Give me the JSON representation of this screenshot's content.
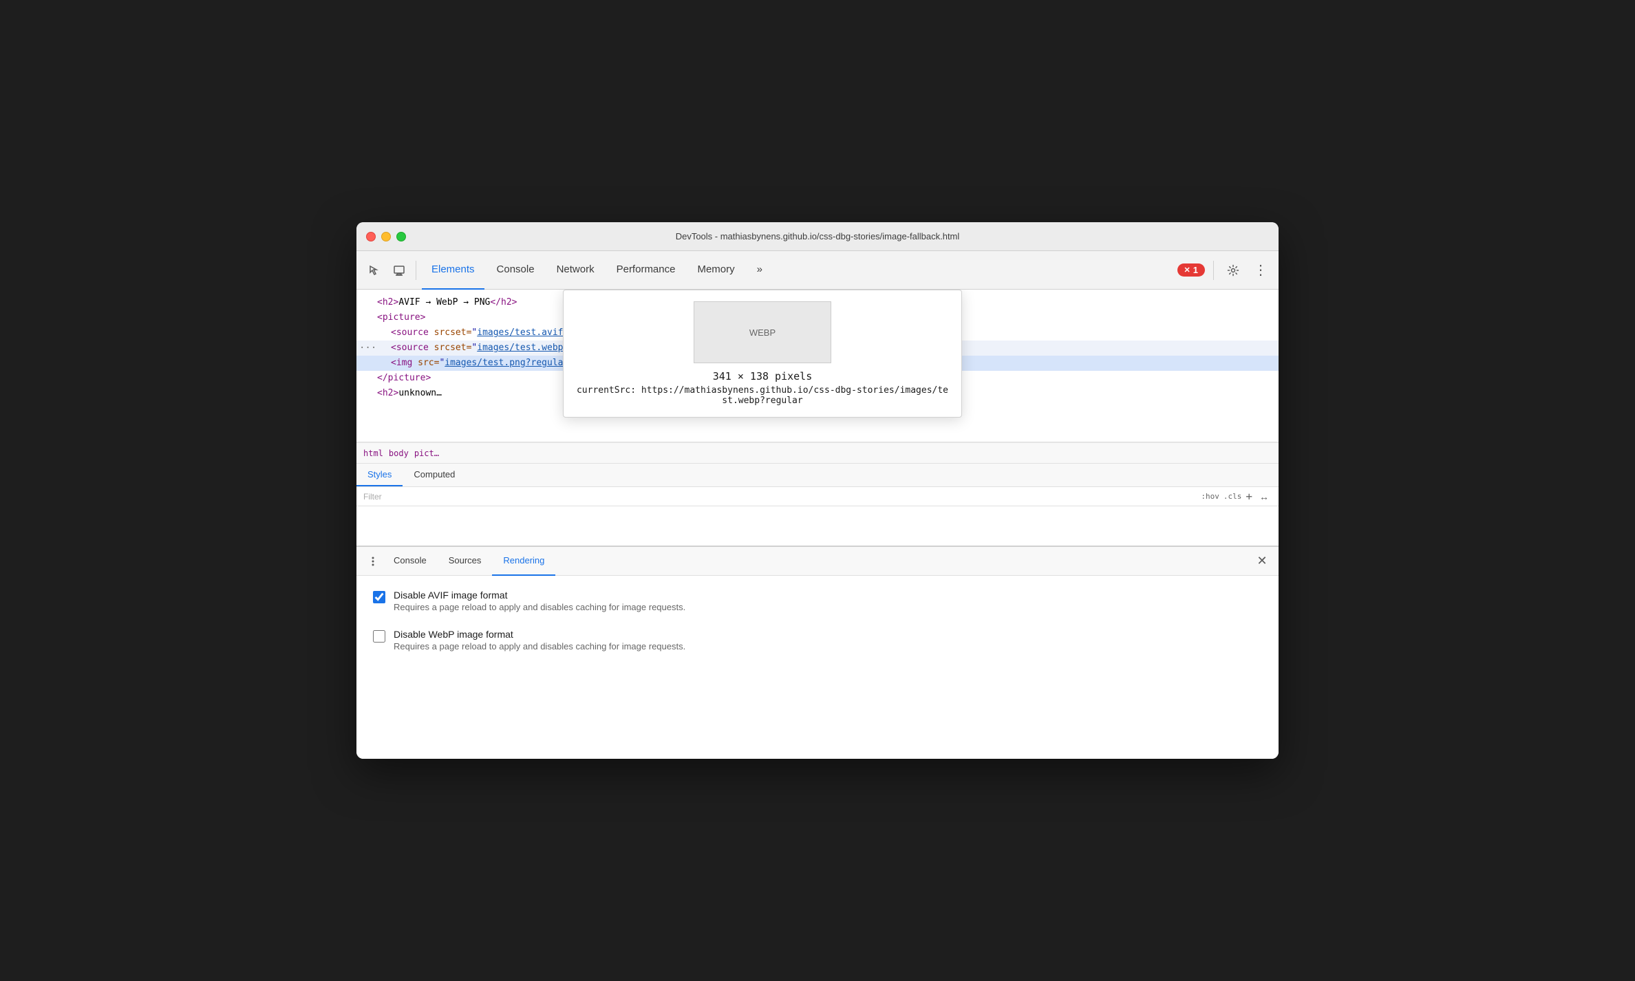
{
  "window": {
    "title": "DevTools - mathiasbynens.github.io/css-dbg-stories/image-fallback.html"
  },
  "toolbar": {
    "tabs": [
      {
        "id": "elements",
        "label": "Elements",
        "active": true
      },
      {
        "id": "console",
        "label": "Console",
        "active": false
      },
      {
        "id": "network",
        "label": "Network",
        "active": false
      },
      {
        "id": "performance",
        "label": "Performance",
        "active": false
      },
      {
        "id": "memory",
        "label": "Memory",
        "active": false
      },
      {
        "id": "more",
        "label": "»",
        "active": false
      }
    ],
    "error_count": "1",
    "settings_label": "⚙",
    "more_label": "⋮"
  },
  "elements": {
    "lines": [
      {
        "text": "<h2>AVIF → WebP → PNG</h2>",
        "indent": 0,
        "type": "tag"
      },
      {
        "text": "<picture>",
        "indent": 1,
        "type": "tag"
      },
      {
        "text": "<source srcset=\"images/test.avif?regular\"  type=\"image/avif\">",
        "indent": 2,
        "type": "source_avif"
      },
      {
        "text": "<source srcset=\"images/test.webp?regular\"  type=\"image/webp\"> == $0",
        "indent": 2,
        "type": "source_webp",
        "selected": false
      },
      {
        "text": "<img src=\"images/test.png?regular\"  width=\"341\"  height=\"138\"  alt>",
        "indent": 2,
        "type": "img",
        "selected": true
      },
      {
        "text": "</picture>",
        "indent": 1,
        "type": "tag"
      },
      {
        "text": "<h2>unknown…",
        "indent": 0,
        "type": "tag"
      }
    ]
  },
  "breadcrumb": {
    "items": [
      "html",
      "body",
      "pict…"
    ]
  },
  "side_tabs": [
    {
      "label": "Styles",
      "active": true
    },
    {
      "label": "Computed",
      "active": false
    }
  ],
  "filter": {
    "placeholder": "Filter",
    "right_items": [
      ":hov",
      ".cls",
      "+",
      "↔"
    ]
  },
  "image_tooltip": {
    "preview_label": "WEBP",
    "dimensions": "341 × 138 pixels",
    "current_src_label": "currentSrc:",
    "current_src_url": "https://mathiasbynens.github.io/css-dbg-stories/images/test.webp?regular"
  },
  "drawer": {
    "menu_label": "⋮",
    "tabs": [
      {
        "label": "Console",
        "active": false
      },
      {
        "label": "Sources",
        "active": false
      },
      {
        "label": "Rendering",
        "active": true
      }
    ],
    "close_label": "✕",
    "checkboxes": [
      {
        "id": "avif",
        "label": "Disable AVIF image format",
        "description": "Requires a page reload to apply and disables caching for image requests.",
        "checked": true
      },
      {
        "id": "webp",
        "label": "Disable WebP image format",
        "description": "Requires a page reload to apply and disables caching for image requests.",
        "checked": false
      }
    ]
  }
}
